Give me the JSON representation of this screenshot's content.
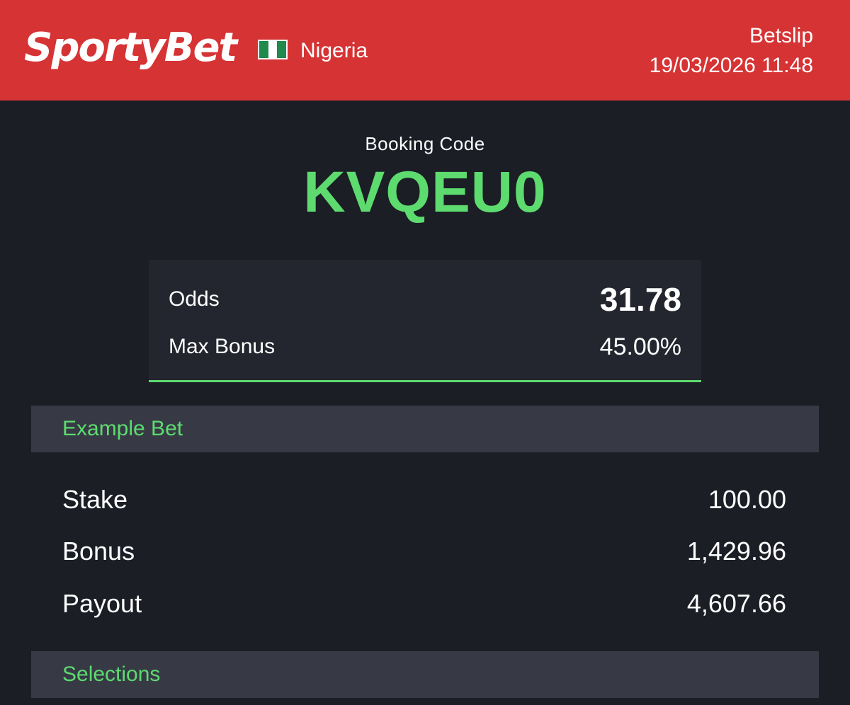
{
  "header": {
    "brand": "SportyBet",
    "country": "Nigeria",
    "title": "Betslip",
    "datetime": "19/03/2026 11:48",
    "flag_colors": [
      "#1f8a4c",
      "#ffffff",
      "#1f8a4c"
    ]
  },
  "booking": {
    "label": "Booking Code",
    "code": "KVQEU0"
  },
  "summary": {
    "odds_label": "Odds",
    "odds_value": "31.78",
    "max_bonus_label": "Max Bonus",
    "max_bonus_value": "45.00%"
  },
  "example_bet": {
    "title": "Example Bet",
    "rows": [
      {
        "label": "Stake",
        "value": "100.00"
      },
      {
        "label": "Bonus",
        "value": "1,429.96"
      },
      {
        "label": "Payout",
        "value": "4,607.66"
      }
    ]
  },
  "selections": {
    "title": "Selections"
  },
  "colors": {
    "header_bg": "#d63334",
    "page_bg": "#1b1e25",
    "accent_green": "#5ddb6f",
    "section_bg": "#373a45"
  }
}
